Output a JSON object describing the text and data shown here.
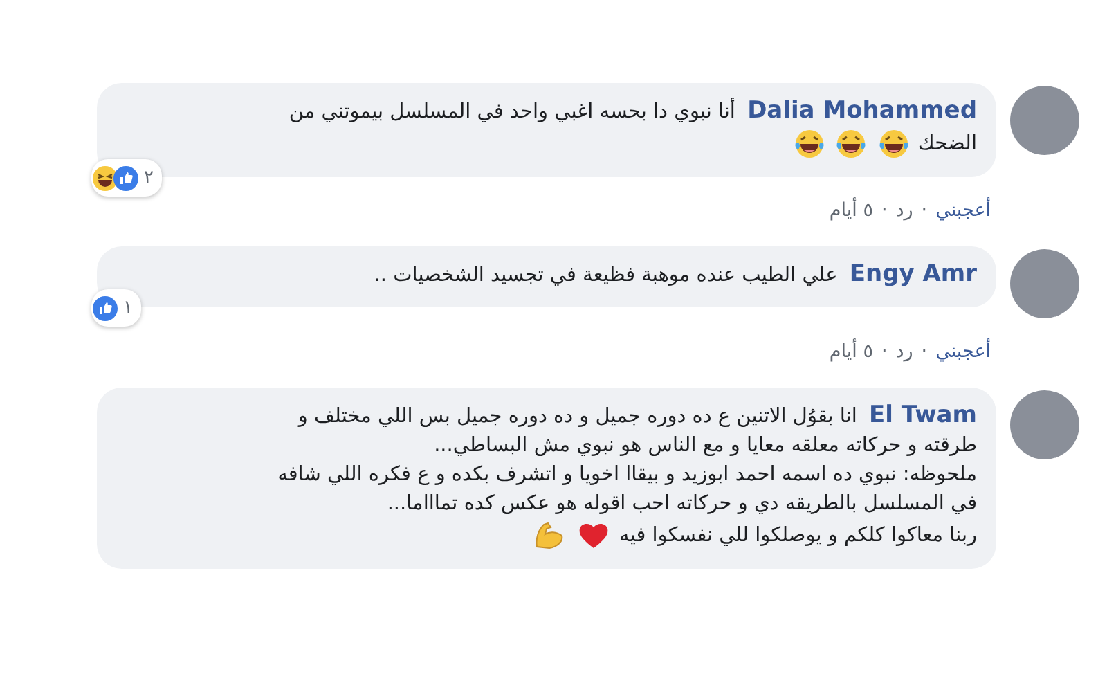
{
  "comments": [
    {
      "author": "Dalia Mohammed",
      "lines": [
        "أنا نبوي دا بحسه اغبي واحد في المسلسل بيموتني من",
        "الضحك"
      ],
      "emojis": [
        {
          "kind": "laugh"
        },
        {
          "kind": "laugh"
        },
        {
          "kind": "laugh"
        }
      ],
      "reactions": {
        "icons": [
          {
            "kind": "like"
          },
          {
            "kind": "haha"
          }
        ],
        "count": "٢"
      },
      "actions": {
        "like": "أعجبني",
        "reply": "رد",
        "separator": "·",
        "time": "٥ أيام"
      }
    },
    {
      "author": "Engy Amr",
      "lines": [
        "علي الطيب عنده موهبة فظيعة في تجسيد الشخصيات .."
      ],
      "reactions": {
        "icons": [
          {
            "kind": "like"
          }
        ],
        "count": "١"
      },
      "actions": {
        "like": "أعجبني",
        "reply": "رد",
        "separator": "·",
        "time": "٥ أيام"
      }
    },
    {
      "author": "El Twam",
      "lines": [
        "انا بقوُل الاتنين ع ده دوره جميل و ده دوره جميل بس اللي مختلف و",
        "طرقته و حركاته معلقه معايا و مع الناس هو نبوي مش البساطي...",
        "ملحوظه: نبوي ده اسمه احمد ابوزيد و بيقاا اخويا و اتشرف بكده و ع فكره اللي شافه",
        "في المسلسل بالطريقه دي و حركاته احب اقوله هو عكس كده تماااما...",
        "ربنا معاكوا كلكم و يوصلكوا للي نفسكوا فيه"
      ],
      "emojis": [
        {
          "kind": "heart"
        },
        {
          "kind": "muscle"
        }
      ]
    }
  ]
}
